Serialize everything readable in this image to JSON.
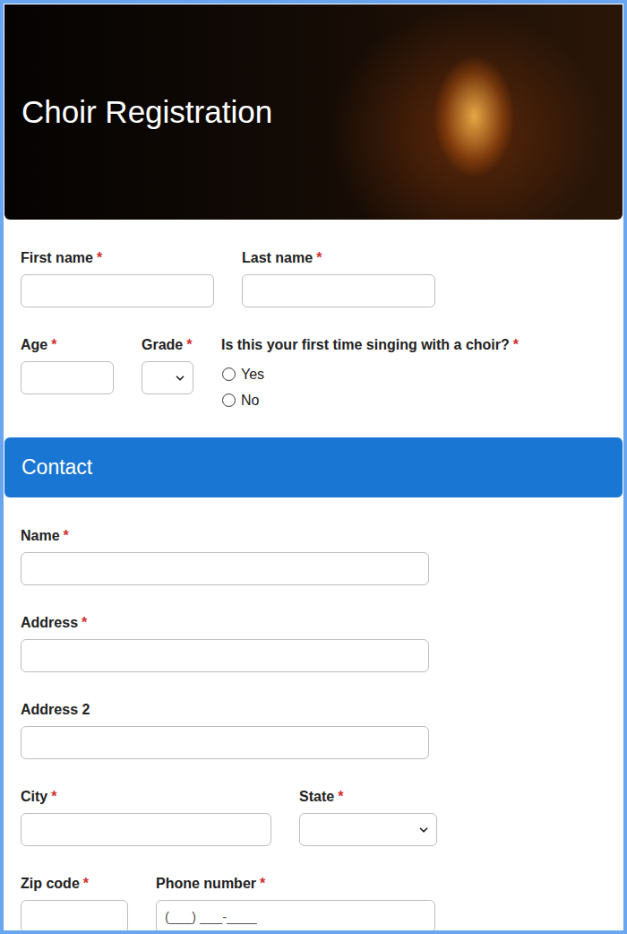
{
  "header": {
    "title": "Choir Registration"
  },
  "required_mark": "*",
  "student": {
    "rows": [
      [
        {
          "kind": "text",
          "label": "First name",
          "required": true,
          "value": "",
          "placeholder": ""
        },
        {
          "kind": "text",
          "label": "Last name",
          "required": true,
          "value": "",
          "placeholder": ""
        }
      ],
      [
        {
          "kind": "text",
          "label": "Age",
          "required": true,
          "value": "",
          "placeholder": ""
        },
        {
          "kind": "select",
          "label": "Grade",
          "required": true,
          "value": "",
          "placeholder": ""
        },
        {
          "kind": "radio",
          "label": "Is this your first time singing with a choir?",
          "required": true,
          "value": "",
          "placeholder": "",
          "options": [
            {
              "label": "Yes",
              "selected": false
            },
            {
              "label": "No",
              "selected": false
            }
          ]
        }
      ]
    ]
  },
  "contact": {
    "title": "Contact",
    "rows": [
      [
        {
          "kind": "text",
          "label": "Name",
          "required": true,
          "value": "",
          "placeholder": ""
        }
      ],
      [
        {
          "kind": "text",
          "label": "Address",
          "required": true,
          "value": "",
          "placeholder": ""
        }
      ],
      [
        {
          "kind": "text",
          "label": "Address 2",
          "required": false,
          "value": "",
          "placeholder": ""
        }
      ],
      [
        {
          "kind": "text",
          "label": "City",
          "required": true,
          "value": "",
          "placeholder": ""
        },
        {
          "kind": "select",
          "label": "State",
          "required": true,
          "value": "",
          "placeholder": ""
        }
      ],
      [
        {
          "kind": "text",
          "label": "Zip code",
          "required": true,
          "value": "",
          "placeholder": ""
        },
        {
          "kind": "text",
          "label": "Phone number",
          "required": true,
          "value": "",
          "placeholder": "(___) ___-____"
        }
      ]
    ]
  }
}
